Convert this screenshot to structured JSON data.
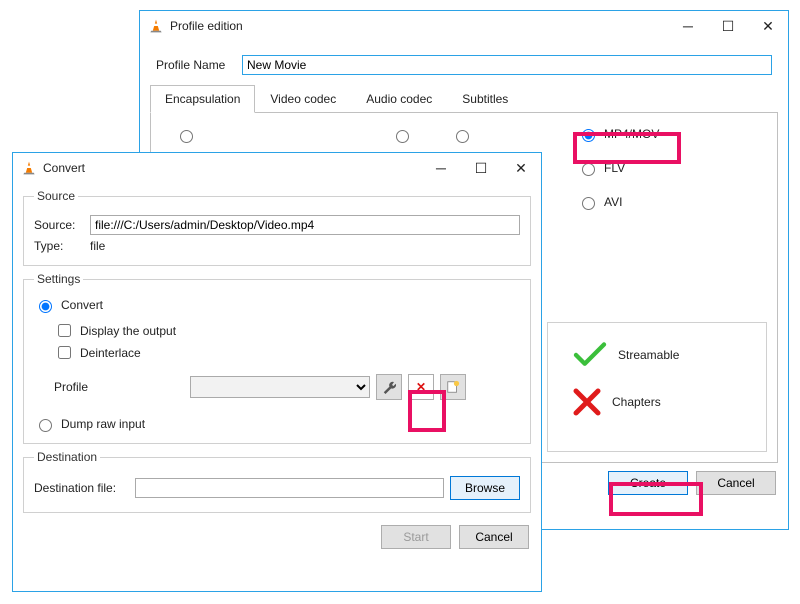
{
  "profileWindow": {
    "title": "Profile edition",
    "profileNameLabel": "Profile Name",
    "profileNameValue": "New Movie",
    "tabs": {
      "encapsulation": "Encapsulation",
      "videoCodec": "Video codec",
      "audioCodec": "Audio codec",
      "subtitles": "Subtitles"
    },
    "options": {
      "mp4mov": "MP4/MOV",
      "flv": "FLV",
      "avi": "AVI"
    },
    "status": {
      "streamable": "Streamable",
      "chapters": "Chapters"
    },
    "createBtn": "Create",
    "cancelBtn": "Cancel"
  },
  "convertWindow": {
    "title": "Convert",
    "source": {
      "legend": "Source",
      "sourceLabel": "Source:",
      "sourceValue": "file:///C:/Users/admin/Desktop/Video.mp4",
      "typeLabel": "Type:",
      "typeValue": "file"
    },
    "settings": {
      "legend": "Settings",
      "convert": "Convert",
      "displayOutput": "Display the output",
      "deinterlace": "Deinterlace",
      "profileLabel": "Profile",
      "dumpRaw": "Dump raw input"
    },
    "destination": {
      "legend": "Destination",
      "destFileLabel": "Destination file:",
      "destFileValue": "",
      "browseBtn": "Browse"
    },
    "startBtn": "Start",
    "cancelBtn": "Cancel"
  }
}
